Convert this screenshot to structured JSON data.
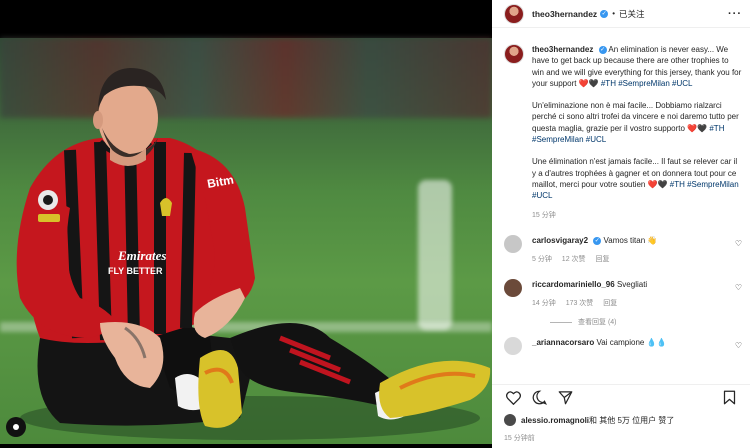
{
  "post": {
    "username": "theo3hernandez",
    "follow_status": "已关注",
    "more_glyph": "···",
    "caption": {
      "en": "An elimination is never easy... We have to get back up because there are other trophies to win and we will give everything for this jersey, thank you for your support ❤️🖤",
      "en_tags": "#TH #SempreMilan #UCL",
      "it": "Un'eliminazione non è mai facile... Dobbiamo rialzarci perché ci sono altri trofei da vincere e noi daremo tutto per questa maglia, grazie per il vostro supporto ❤️🖤",
      "it_tags": "#TH #SempreMilan #UCL",
      "fr": "Une élimination n'est jamais facile... Il faut se relever car il y a d'autres trophées à gagner et on donnera tout pour ce maillot, merci pour votre soutien ❤️🖤",
      "fr_tags": "#TH #SempreMilan #UCL",
      "time": "15 分钟"
    },
    "comments": [
      {
        "user": "carlosvigaray2",
        "text": "Vamos titan 👋",
        "time": "5 分钟",
        "likes": "12 次赞",
        "reply": "回复",
        "verified": true,
        "avatar_color": "#c7c7c7"
      },
      {
        "user": "riccardomariniello_96",
        "text": "Svegliati",
        "time": "14 分钟",
        "likes": "173 次赞",
        "reply": "回复",
        "verified": false,
        "avatar_color": "#6b4a3a",
        "view_replies": "查看回复 (4)"
      },
      {
        "user": "_ariannacorsaro",
        "text": "Vai campione 💧💧",
        "verified": false,
        "avatar_color": "#d9d9d9"
      }
    ],
    "likes_line": {
      "user": "alessio.romagnoli",
      "text": " 和 其他 5万 位用户 赞了"
    },
    "post_time": "15 分钟前"
  },
  "photo": {
    "shirt_text": "Emirates FLY BETTER",
    "sleeve_text": "Bitm",
    "icons": [
      "heart-icon",
      "comment-icon",
      "share-icon",
      "bookmark-icon"
    ]
  }
}
